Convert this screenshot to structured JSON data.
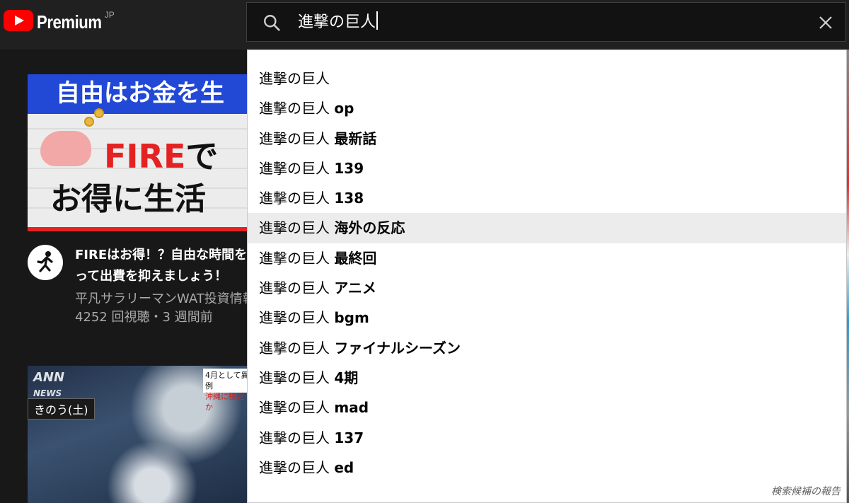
{
  "masthead": {
    "logo_text": "Premium",
    "logo_region": "JP",
    "search_value": "進撃の巨人"
  },
  "suggestions": [
    {
      "typed": "進撃の巨人",
      "extra": ""
    },
    {
      "typed": "進撃の巨人",
      "extra": "op"
    },
    {
      "typed": "進撃の巨人",
      "extra": "最新話"
    },
    {
      "typed": "進撃の巨人",
      "extra": "139"
    },
    {
      "typed": "進撃の巨人",
      "extra": "138"
    },
    {
      "typed": "進撃の巨人",
      "extra": "海外の反応"
    },
    {
      "typed": "進撃の巨人",
      "extra": "最終回"
    },
    {
      "typed": "進撃の巨人",
      "extra": "アニメ"
    },
    {
      "typed": "進撃の巨人",
      "extra": "bgm"
    },
    {
      "typed": "進撃の巨人",
      "extra": "ファイナルシーズン"
    },
    {
      "typed": "進撃の巨人",
      "extra": "4期"
    },
    {
      "typed": "進撃の巨人",
      "extra": "mad"
    },
    {
      "typed": "進撃の巨人",
      "extra": "137"
    },
    {
      "typed": "進撃の巨人",
      "extra": "ed"
    }
  ],
  "report_link": "検索候補の報告",
  "video1": {
    "thumb_banner": "自由はお金を生",
    "thumb_fire": "FIRE",
    "thumb_de": "で",
    "thumb_line2": "お得に生活",
    "title_line1": "FIREはお得！？自由な時間を",
    "title_line2": "って出費を抑えましょう！",
    "channel": "平凡サラリーマンWAT投資情報",
    "meta": "4252 回視聴・3 週間前"
  },
  "video2": {
    "ann": "ANN",
    "news": "NEWS",
    "kinou": "きのう(土)",
    "caption_line1": "4月として異例",
    "caption_line2": "沖縄に接近か"
  }
}
